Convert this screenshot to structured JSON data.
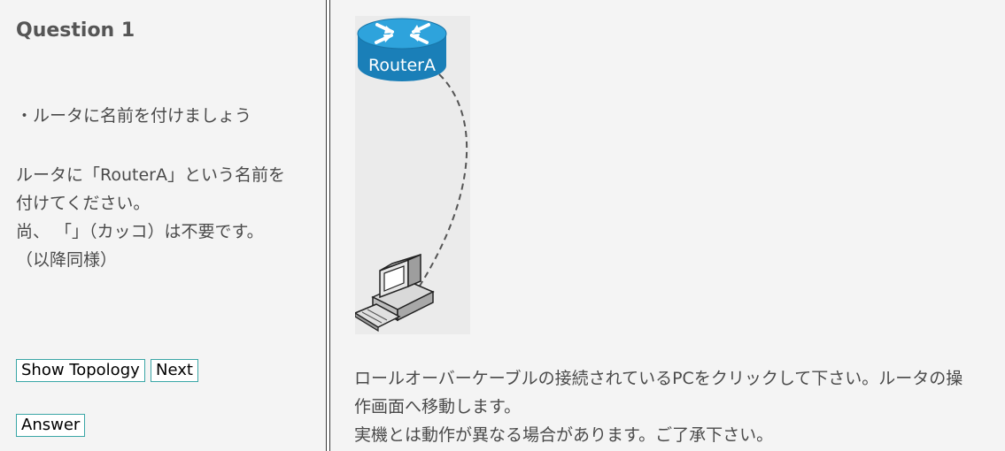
{
  "question": {
    "title": "Question 1",
    "bullet": "・ルータに名前を付けましょう",
    "instructions": [
      "ルータに「RouterA」という名前を",
      "付けてください。",
      "尚、 「」（カッコ）は不要です。",
      "（以降同様）"
    ]
  },
  "buttons": {
    "show_topology": "Show Topology",
    "next": "Next",
    "answer": "Answer"
  },
  "topology": {
    "router_label": "RouterA",
    "router_icon": "router-icon",
    "pc_icon": "pc-icon",
    "cable": "rollover-cable",
    "router_color": "#1e90c8"
  },
  "message": [
    "ロールオーバーケーブルの接続されているPCをクリックして下さい。ルータの操",
    "作画面へ移動します。",
    "実機とは動作が異なる場合があります。ご了承下さい。"
  ]
}
